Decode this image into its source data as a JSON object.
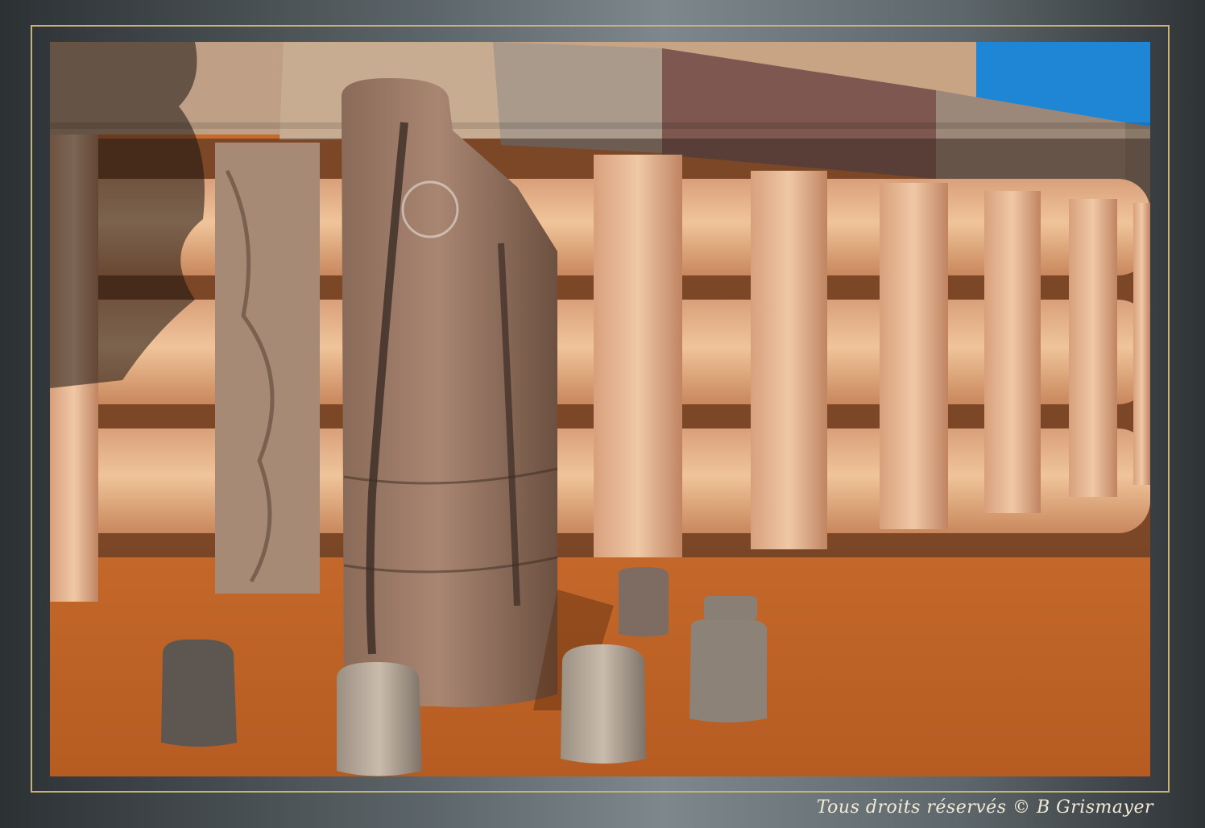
{
  "caption": {
    "text": "Tous droits réservés © B Grismayer"
  },
  "colors": {
    "frame_gold": "#c9b27a",
    "sky_blue": "#1f86d6",
    "ground_orange": "#c96a2a",
    "sandstone": "#e0ad80"
  }
}
